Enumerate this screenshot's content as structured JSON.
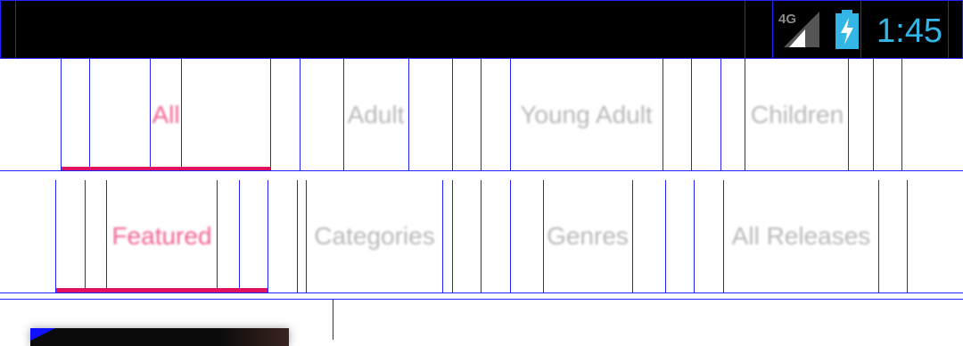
{
  "status_bar": {
    "network_label": "4G",
    "time": "1:45",
    "icons": [
      "signal-4g-icon",
      "battery-charging-icon"
    ],
    "clock_color": "#33b5e5"
  },
  "audience_tabs": {
    "items": [
      {
        "label": "All",
        "active": true
      },
      {
        "label": "Adult",
        "active": false
      },
      {
        "label": "Young Adult",
        "active": false
      },
      {
        "label": "Children",
        "active": false
      }
    ]
  },
  "section_tabs": {
    "items": [
      {
        "label": "Featured",
        "active": true
      },
      {
        "label": "Categories",
        "active": false
      },
      {
        "label": "Genres",
        "active": false
      },
      {
        "label": "All Releases",
        "active": false
      }
    ]
  },
  "colors": {
    "accent": "#e0115f",
    "active_text": "#f06292",
    "inactive_text": "#b8b8b8"
  }
}
